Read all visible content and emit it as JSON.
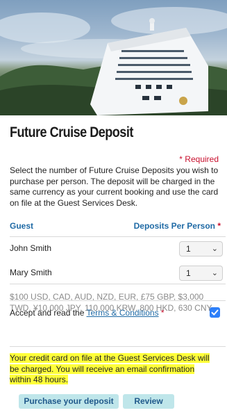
{
  "page": {
    "title": "Future Cruise Deposit",
    "required_note": "* Required",
    "intro": "Select the number of Future Cruise Deposits you wish to purchase per person. The deposit will be charged in the same currency as your current booking and use the card on file at the Guest Services Desk."
  },
  "table": {
    "col_guest": "Guest",
    "col_deposits": "Deposits Per Person",
    "required_star": "*",
    "rows": [
      {
        "name": "John Smith",
        "deposits": "1"
      },
      {
        "name": "Mary Smith",
        "deposits": "1"
      }
    ]
  },
  "currencies": "$100 USD, CAD, AUD, NZD, EUR, £75 GBP, $3,000 TWD, ¥10,000 JPY, 110,000 KRW, 800 HKD, 630 CNY.",
  "terms": {
    "prefix": "Accept and read the ",
    "link": "Terms & Conditions",
    "star": "*",
    "checked": true
  },
  "notice": "Your credit card on file at the Guest Services Desk will be charged. You will receive an email confirmation within 48 hours.",
  "buttons": {
    "purchase": "Purchase your deposit",
    "review": "Review"
  },
  "icons": {
    "hero": "cruise-ship-photo",
    "dropdown": "chevron-down-icon",
    "checkbox": "checkmark-icon"
  },
  "colors": {
    "accent_blue": "#1f6aa5",
    "required_red": "#c8102e",
    "button_bg": "#bfe6ea",
    "highlight": "#ffff3a",
    "checkbox": "#2d7ff9"
  }
}
